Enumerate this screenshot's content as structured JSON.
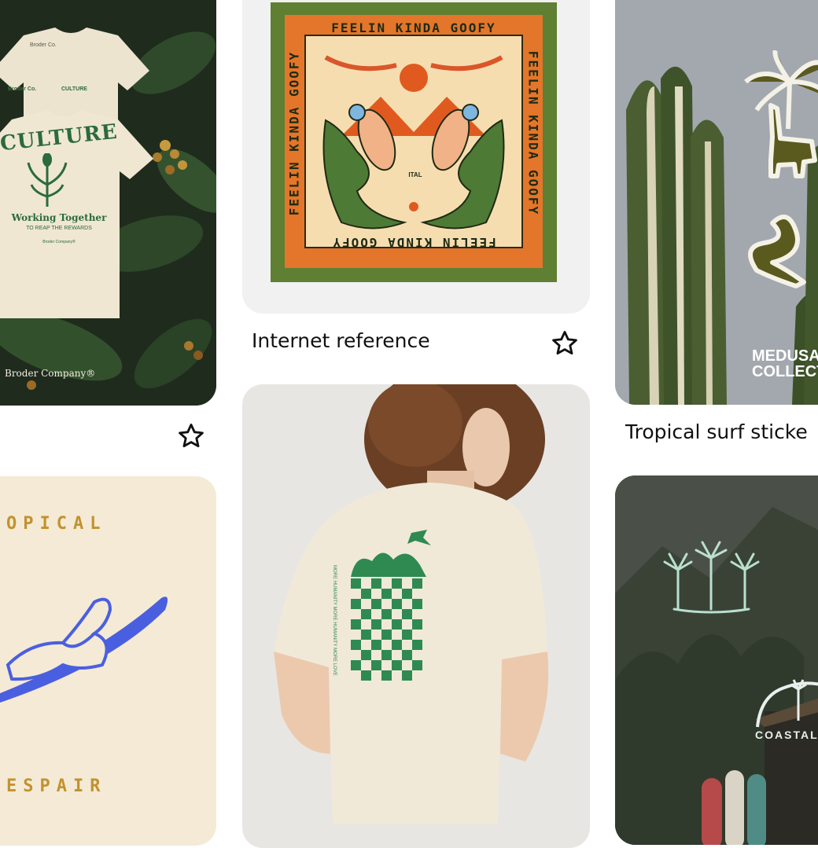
{
  "pins": [
    {
      "id": "tshirt-culture",
      "front_brand": "Broder Co.",
      "pocket_text": "CULTURE",
      "print_title": "CULTURE",
      "print_line1": "Working Together",
      "print_line2": "TO REAP THE REWARDS",
      "print_small": "Broder Company®",
      "photo_credit": "Broder Company®"
    },
    {
      "id": "bandana",
      "border_text": "FEELIN KINDA GOOFY",
      "center_text": "ITAL",
      "caption": "Internet reference"
    },
    {
      "id": "cactus-stickers",
      "brand_line1": "MEDUSA",
      "brand_line2": "COLLECT",
      "caption": "Tropical surf sticke"
    },
    {
      "id": "tropical-despair",
      "top_text": "OPICAL",
      "bottom_text": "ESPAIR"
    },
    {
      "id": "checker-tshirt",
      "print_arc_text": "MORE HUMANITY MORE HUMANITY MORE LOVE"
    },
    {
      "id": "coastal",
      "brand_text": "COASTAL"
    }
  ],
  "icons": {
    "save": "star-outline-icon"
  },
  "colors": {
    "caption_text": "#111111",
    "bandana_green": "#5f7f33",
    "bandana_orange": "#e3762a",
    "sticker_olive": "#5a5a1e",
    "surf_blue": "#4a5fe0",
    "cream": "#f4ead6",
    "shirt_green": "#2f8a52"
  }
}
